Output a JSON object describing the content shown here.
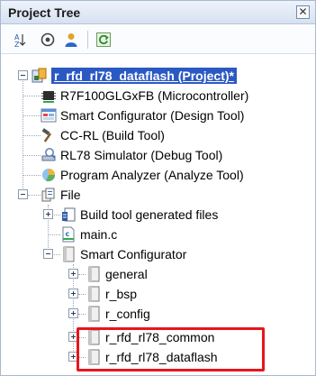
{
  "panel": {
    "title": "Project Tree",
    "close_label": "✕"
  },
  "toolbar": {
    "buttons": [
      {
        "icon": "sort-icon"
      },
      {
        "icon": "properties-icon"
      },
      {
        "icon": "user-icon"
      },
      {
        "icon": "refresh-icon"
      }
    ]
  },
  "tree": {
    "root": "r_rfd_rl78_dataflash (Project)*",
    "items": {
      "mcu": "R7F100GLGxFB (Microcontroller)",
      "smartconf_tool": "Smart Configurator (Design Tool)",
      "ccrl": "CC-RL (Build Tool)",
      "simulator": "RL78 Simulator (Debug Tool)",
      "analyzer": "Program Analyzer (Analyze Tool)",
      "file": "File",
      "build_generated": "Build tool generated files",
      "main_c": "main.c",
      "smart_configurator": "Smart Configurator",
      "general": "general",
      "r_bsp": "r_bsp",
      "r_config": "r_config",
      "r_rfd_common": "r_rfd_rl78_common",
      "r_rfd_dataflash": "r_rfd_rl78_dataflash"
    }
  },
  "colors": {
    "highlight": "#e8141e",
    "selection": "#2b59c3"
  }
}
